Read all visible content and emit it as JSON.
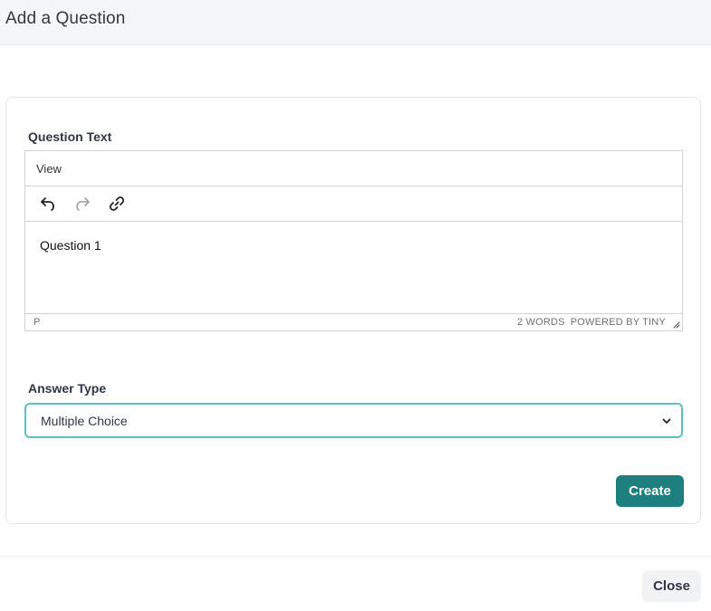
{
  "modal": {
    "title": "Add a Question"
  },
  "question_text": {
    "label": "Question Text",
    "editor": {
      "menu": [
        "View"
      ],
      "toolbar": {
        "undo_icon": "undo-icon",
        "redo_icon": "redo-icon",
        "link_icon": "link-icon"
      },
      "content": "Question 1",
      "status": {
        "path": "P",
        "word_count": "2 WORDS",
        "powered_by": "POWERED BY TINY"
      }
    }
  },
  "answer_type": {
    "label": "Answer Type",
    "selected": "Multiple Choice"
  },
  "actions": {
    "create_label": "Create",
    "close_label": "Close"
  },
  "colors": {
    "primary_button": "#1e7f7f",
    "select_focus_border": "#5bbfc1",
    "header_background": "#f5f6f7"
  }
}
